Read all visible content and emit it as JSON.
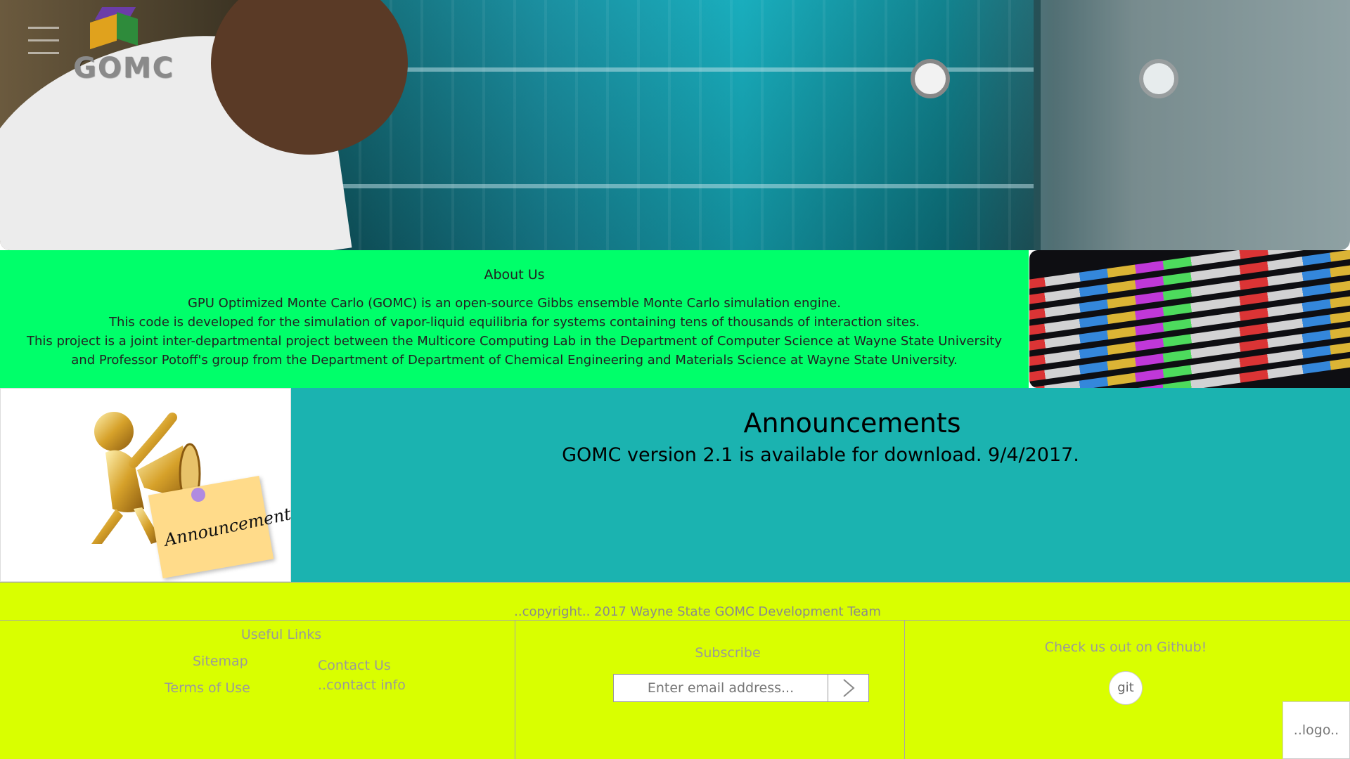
{
  "brand": {
    "logo_text": "GOMC"
  },
  "about": {
    "title": "About Us",
    "lines": [
      "GPU Optimized Monte Carlo (GOMC) is an open-source Gibbs ensemble Monte Carlo simulation engine.",
      "This code is developed for the simulation of vapor-liquid equilibria for systems containing tens of thousands of interaction sites.",
      "This project is a joint inter-departmental project between the Multicore Computing Lab in the Department of Computer Science at Wayne State University",
      "and Professor Potoff's group from the Department of Department of Chemical Engineering and Materials Science at Wayne State University."
    ]
  },
  "announcements": {
    "image_label": "Announcement!",
    "title": "Announcements",
    "text": "GOMC version 2.1 is available for download. 9/4/2017."
  },
  "footer": {
    "copyright": "..copyright.. 2017 Wayne State GOMC Development Team",
    "useful_links": {
      "title": "Useful Links",
      "sitemap": "Sitemap",
      "terms": "Terms of Use",
      "contact": "Contact Us",
      "contact_info": "..contact info"
    },
    "subscribe": {
      "title": "Subscribe",
      "placeholder": "Enter email address..."
    },
    "github": {
      "title": "Check us out on Github!",
      "button": "git"
    },
    "logo": "..logo.."
  },
  "colors": {
    "about_bg": "#00ff6a",
    "announcement_bg": "#1bb3b0",
    "footer_bg": "#d9ff00"
  }
}
